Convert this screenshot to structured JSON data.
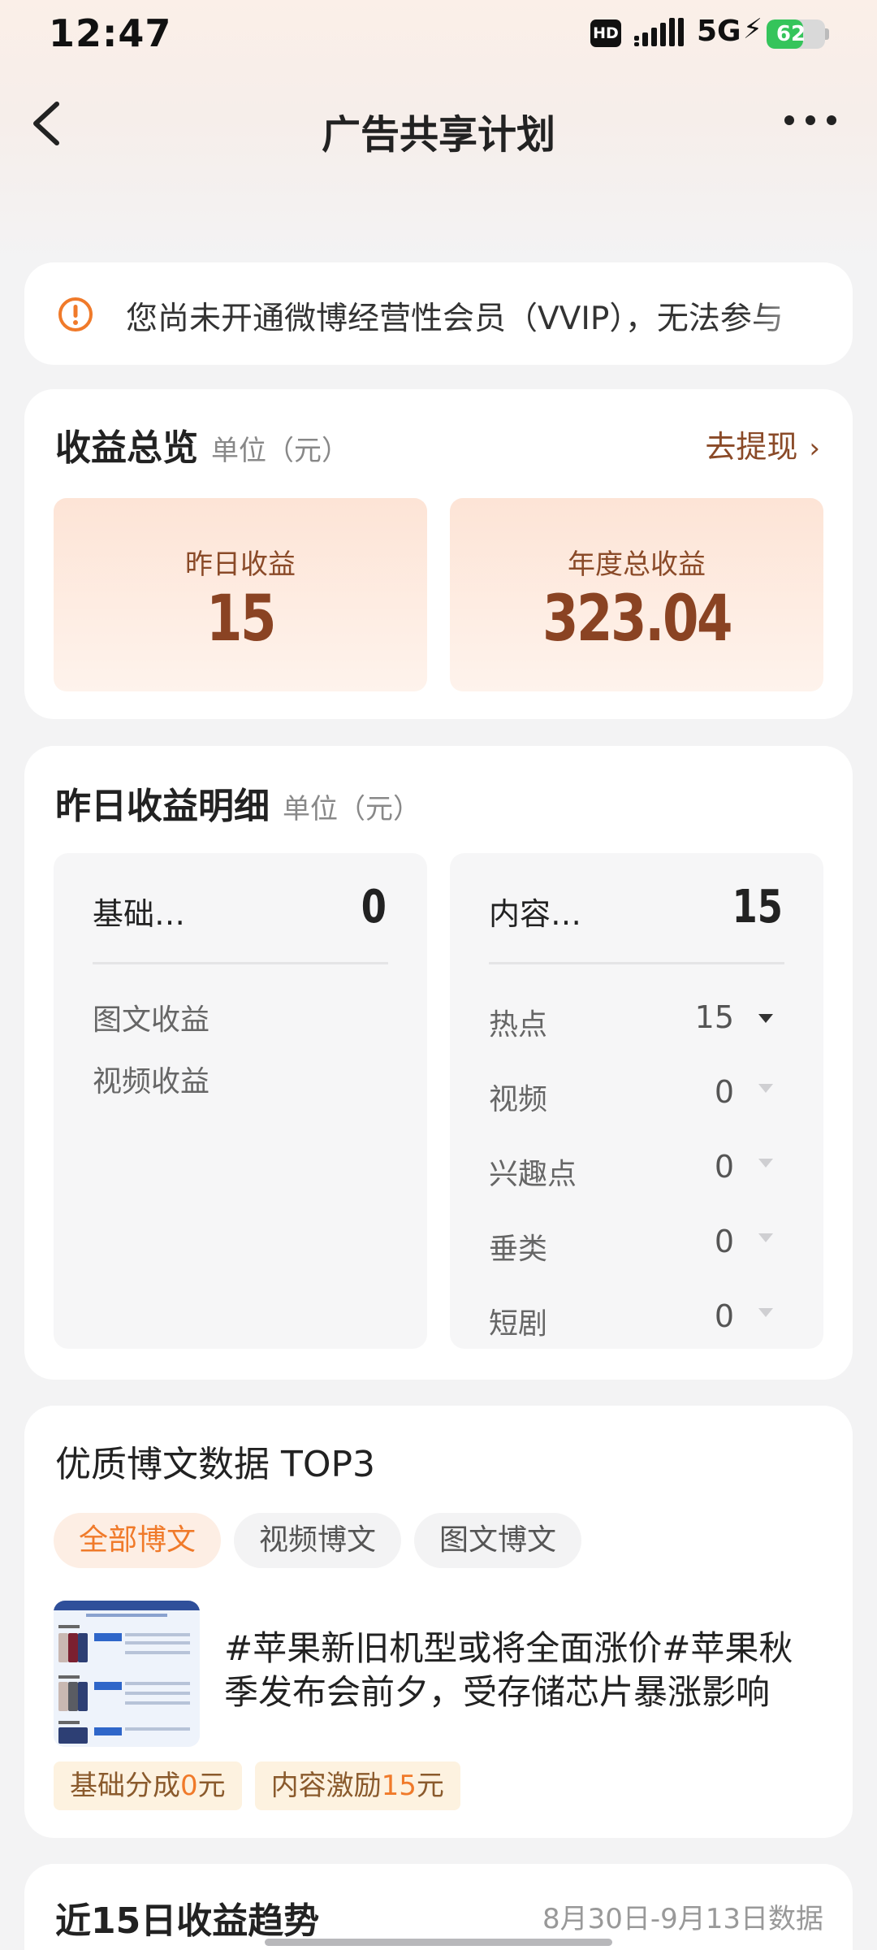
{
  "status_bar": {
    "time": "12:47",
    "hd": "HD",
    "network": "5G",
    "battery": "62",
    "battery_level": 0.62
  },
  "nav": {
    "title": "广告共享计划"
  },
  "notice": {
    "text": "您尚未开通微博经营性会员（VVIP），无法参与"
  },
  "overview": {
    "title": "收益总览",
    "unit": "单位（元）",
    "withdraw_label": "去提现",
    "yesterday_label": "昨日收益",
    "yesterday_value": "15",
    "annual_label": "年度总收益",
    "annual_value": "323.04"
  },
  "detail": {
    "title": "昨日收益明细",
    "unit": "单位（元）",
    "basic": {
      "label": "基础…",
      "value": "0",
      "items": [
        "图文收益",
        "视频收益"
      ]
    },
    "content": {
      "label": "内容…",
      "value": "15",
      "items": [
        {
          "label": "热点",
          "value": "15"
        },
        {
          "label": "视频",
          "value": "0"
        },
        {
          "label": "兴趣点",
          "value": "0"
        },
        {
          "label": "垂类",
          "value": "0"
        },
        {
          "label": "短剧",
          "value": "0"
        }
      ]
    }
  },
  "top3": {
    "title": "优质博文数据 TOP3",
    "tabs": [
      "全部博文",
      "视频博文",
      "图文博文"
    ],
    "post": {
      "text": "#苹果新旧机型或将全面涨价#苹果秋季发布会前夕，受存储芯片暴涨影响"
    },
    "badges": {
      "basic_label": "基础分成",
      "basic_amount": "0",
      "content_label": "内容激励",
      "content_amount": "15",
      "unit": "元"
    }
  },
  "trend": {
    "title": "近15日收益趋势",
    "range": "8月30日-9月13日数据"
  },
  "colors": {
    "accent": "#f07a2a",
    "brown": "#8a4323",
    "battery_green": "#35c45b"
  }
}
